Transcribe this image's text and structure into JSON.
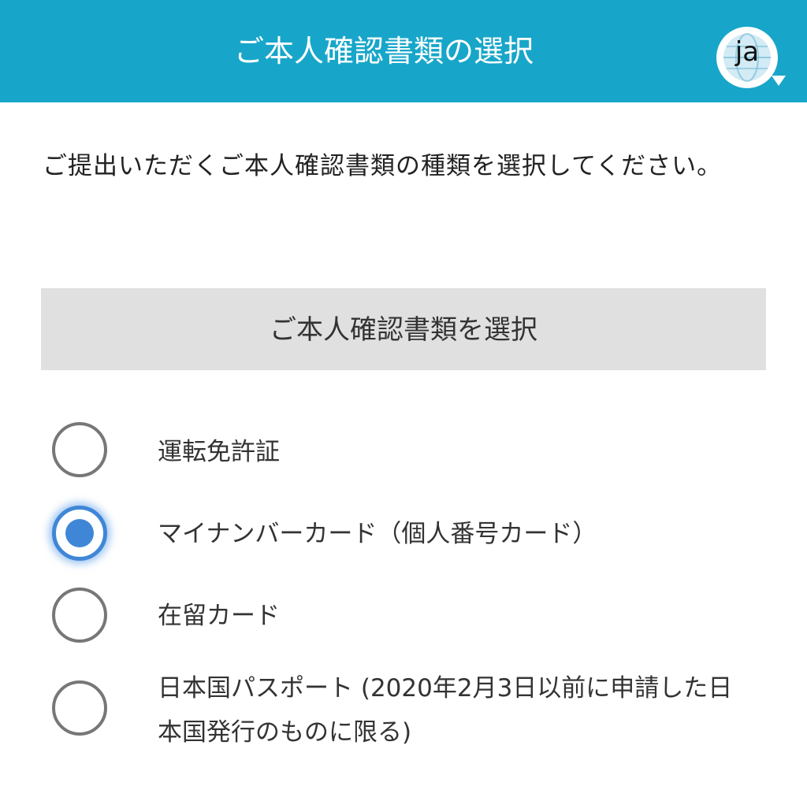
{
  "header": {
    "title": "ご本人確認書類の選択",
    "language_code": "ja",
    "language_icon": "globe-icon",
    "accent_color": "#17a6c9"
  },
  "instruction": "ご提出いただくご本人確認書類の種類を選択してください。",
  "select_button_label": "ご本人確認書類を選択",
  "options": [
    {
      "label": "運転免許証",
      "selected": false
    },
    {
      "label": "マイナンバーカード（個人番号カード）",
      "selected": true
    },
    {
      "label": "在留カード",
      "selected": false
    },
    {
      "label": "日本国パスポート (2020年2月3日以前に申請した日本国発行のものに限る)",
      "selected": false
    }
  ],
  "selected_color": "#3f87d6"
}
